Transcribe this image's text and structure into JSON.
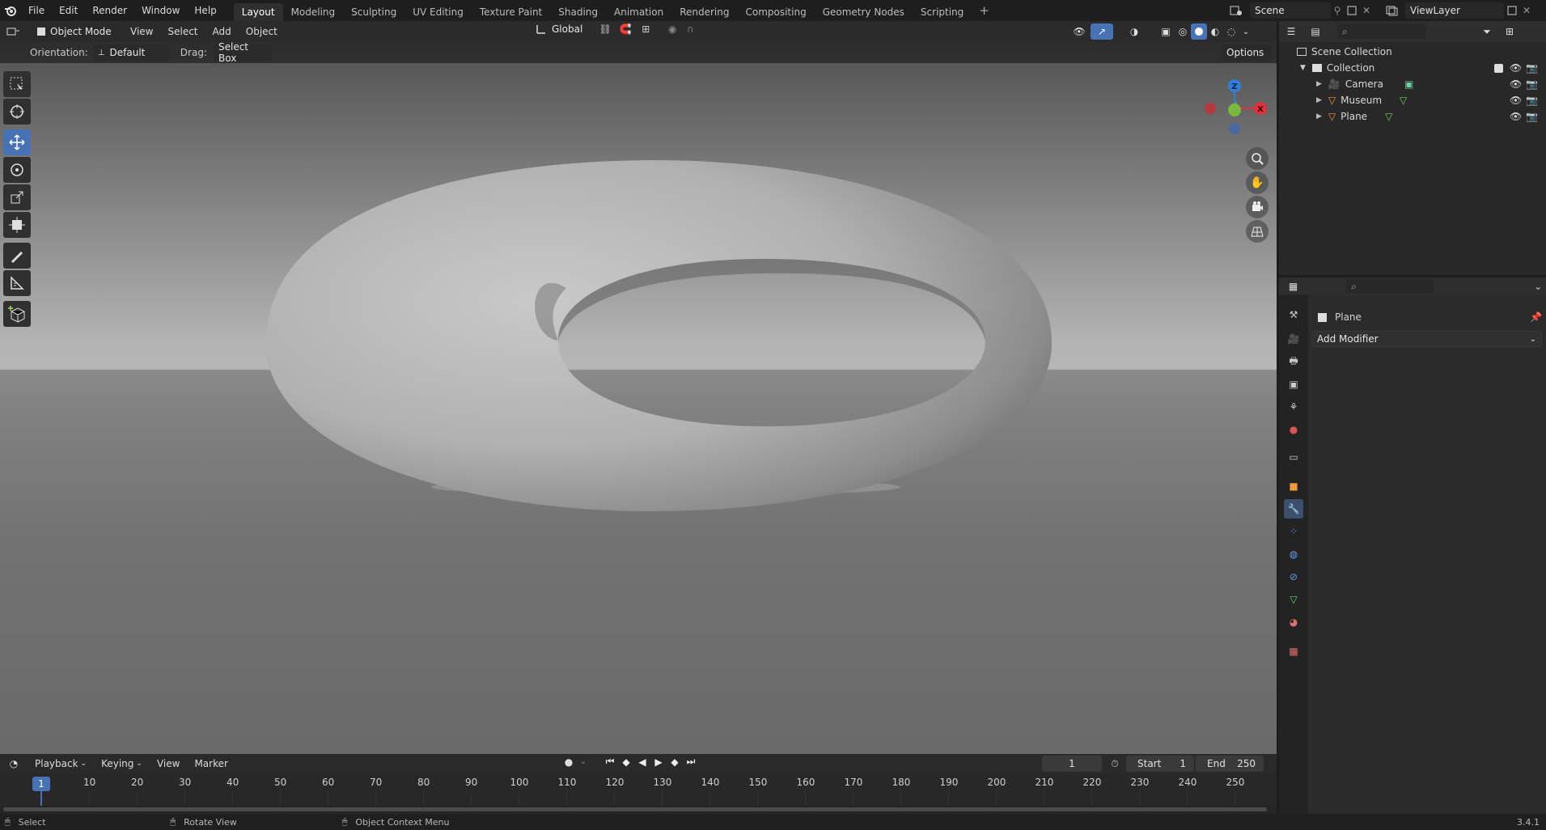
{
  "topbar": {
    "menus": [
      "File",
      "Edit",
      "Render",
      "Window",
      "Help"
    ],
    "workspaces": [
      "Layout",
      "Modeling",
      "Sculpting",
      "UV Editing",
      "Texture Paint",
      "Shading",
      "Animation",
      "Rendering",
      "Compositing",
      "Geometry Nodes",
      "Scripting"
    ],
    "add_tab": "+",
    "scene_name": "Scene",
    "view_layer": "ViewLayer"
  },
  "viewport_header": {
    "mode": "Object Mode",
    "menus": [
      "View",
      "Select",
      "Add",
      "Object"
    ],
    "transform_orientation": "Global",
    "options": "Options"
  },
  "tool_header": {
    "orientation_label": "Orientation:",
    "orientation_value": "Default",
    "drag_label": "Drag:",
    "drag_value": "Select Box"
  },
  "gizmo": {
    "x_label": "X",
    "z_label": "Z"
  },
  "outliner": {
    "root": "Scene Collection",
    "collection": "Collection",
    "objects": [
      {
        "name": "Camera",
        "icon": "camera-data-icon"
      },
      {
        "name": "Museum",
        "icon": "mesh-data-icon"
      },
      {
        "name": "Plane",
        "icon": "mesh-data-icon"
      }
    ]
  },
  "properties": {
    "object_name": "Plane",
    "add_modifier": "Add Modifier"
  },
  "timeline": {
    "menus": [
      "Playback",
      "Keying",
      "View",
      "Marker"
    ],
    "current_frame": "1",
    "start_label": "Start",
    "start_value": "1",
    "end_label": "End",
    "end_value": "250",
    "ticks": [
      "10",
      "20",
      "30",
      "40",
      "50",
      "60",
      "70",
      "80",
      "90",
      "100",
      "110",
      "120",
      "130",
      "140",
      "150",
      "160",
      "170",
      "180",
      "190",
      "200",
      "210",
      "220",
      "230",
      "240",
      "250"
    ],
    "playhead_label": "1"
  },
  "statusbar": {
    "items": [
      "Select",
      "Rotate View",
      "Object Context Menu"
    ],
    "version": "3.4.1"
  },
  "colors": {
    "accent": "#4772b3",
    "axis_x": "#e0323a",
    "axis_y": "#6ea832",
    "axis_z": "#2f7ed8"
  }
}
